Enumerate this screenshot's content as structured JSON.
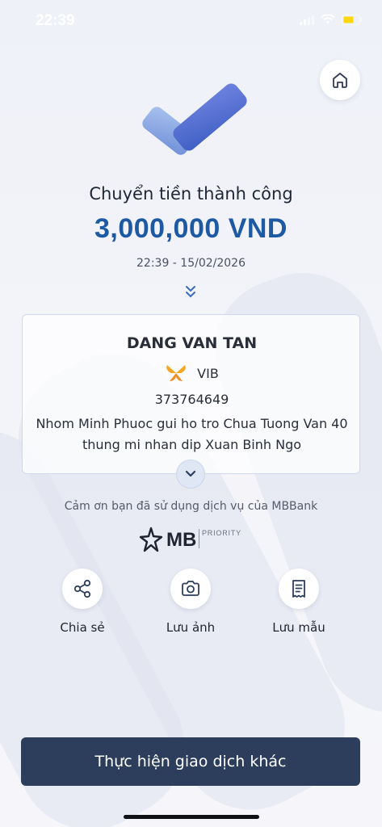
{
  "status_bar": {
    "time": "22:39"
  },
  "header": {
    "home_icon": "home-icon"
  },
  "result": {
    "title": "Chuyển tiền thành công",
    "amount": "3,000,000 VND",
    "datetime": "22:39 - 15/02/2026",
    "success_icon": "checkmark-icon"
  },
  "recipient": {
    "name": "DANG VAN TAN",
    "bank": "VIB",
    "account": "373764649",
    "memo": "Nhom Minh Phuoc gui ho tro Chua Tuong Van 40 thung mi nhan dip Xuan Binh Ngo"
  },
  "footer": {
    "thanks": "Cảm ơn bạn đã sử dụng dịch vụ của MBBank",
    "logo_text": "MB",
    "logo_tier": "PRIORITY"
  },
  "actions": [
    {
      "label": "Chia sẻ",
      "icon": "share-icon"
    },
    {
      "label": "Lưu ảnh",
      "icon": "camera-icon"
    },
    {
      "label": "Lưu mẫu",
      "icon": "receipt-icon"
    }
  ],
  "primary_button": {
    "label": "Thực hiện giao dịch khác"
  },
  "colors": {
    "amount": "#1d5aa3",
    "primary_button": "#2d3e5c",
    "bank_logo": "#f5a623"
  }
}
